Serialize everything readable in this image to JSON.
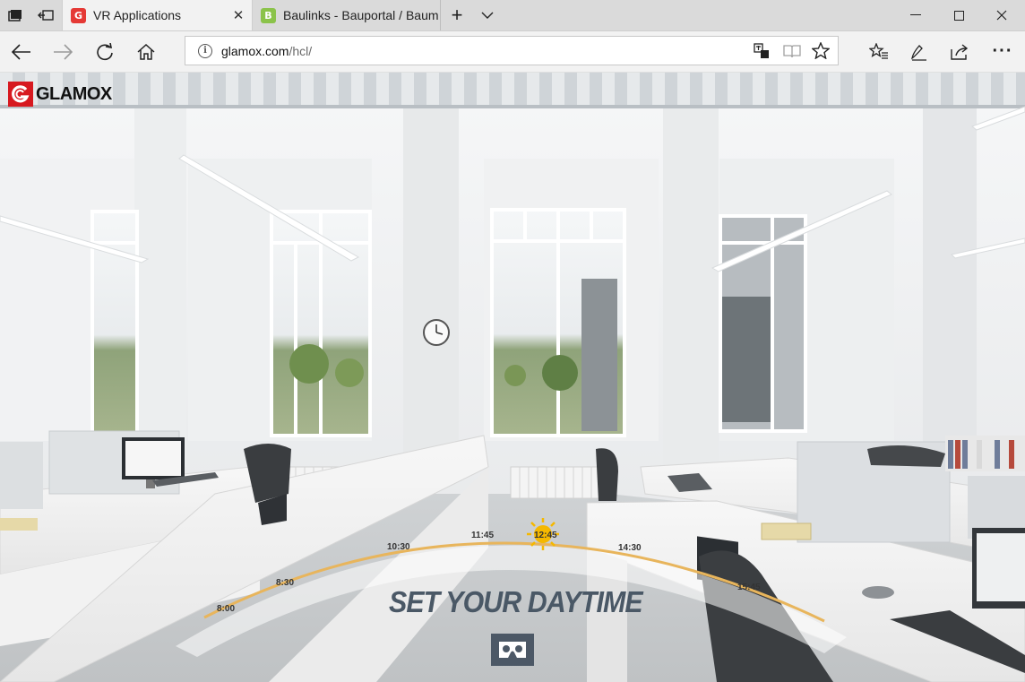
{
  "browser": {
    "tabs": [
      {
        "label": "VR Applications",
        "favicon_letter": "G",
        "favicon_color": "#e53935",
        "active": true
      },
      {
        "label": "Baulinks - Bauportal / Baum",
        "favicon_letter": "B",
        "favicon_color": "#8bc34a",
        "active": false
      }
    ],
    "new_tab_symbol": "+",
    "address": {
      "domain": "glamox.com",
      "path": "/hcl/"
    }
  },
  "page": {
    "brand": "GLAMOX",
    "timeline": {
      "labels": [
        "8:00",
        "8:30",
        "10:30",
        "11:45",
        "12:45",
        "14:30",
        "15:45"
      ],
      "selected": "12:45"
    },
    "heading": "SET YOUR DAYTIME",
    "vr_button_icon": "cardboard-vr-icon"
  },
  "colors": {
    "brand_red": "#d71920",
    "timeline_arc": "#e8b55c",
    "sun": "#f5b800",
    "heading": "#4a5866"
  }
}
